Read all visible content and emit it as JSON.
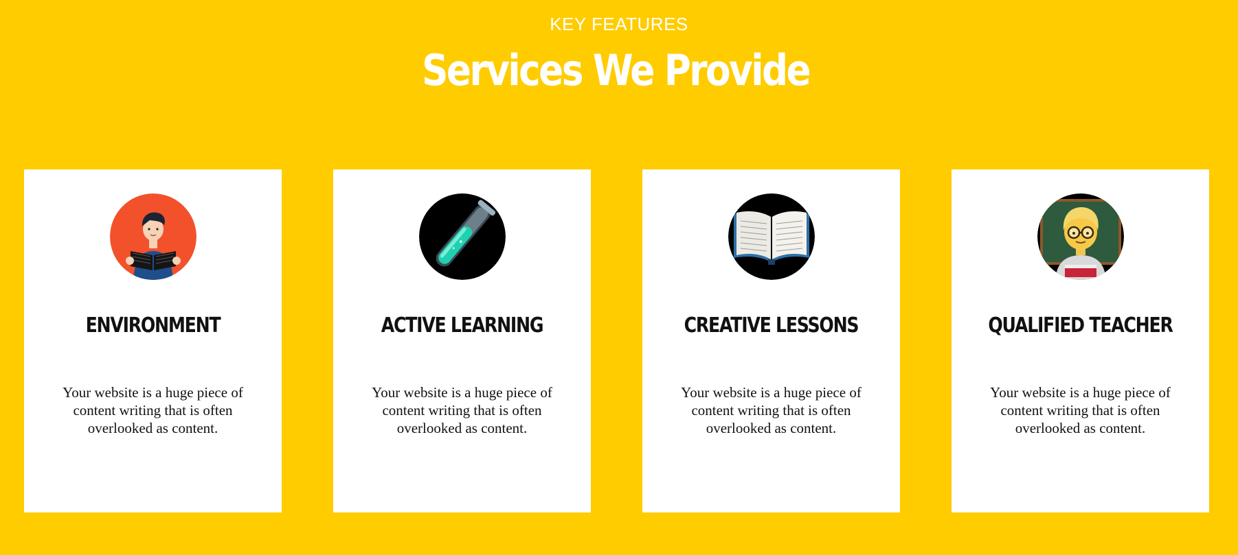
{
  "header": {
    "kicker": "KEY FEATURES",
    "title": "Services We Provide"
  },
  "colors": {
    "background": "#FFCC00",
    "card": "#FFFFFF",
    "heading": "#FFFFFF",
    "text": "#111111"
  },
  "cards": [
    {
      "icon": "reading-student-icon",
      "title": "ENVIRONMENT",
      "text": "Your website is a huge piece of content writing that is often overlooked as content."
    },
    {
      "icon": "test-tube-icon",
      "title": "ACTIVE LEARNING",
      "text": "Your website is a huge piece of content writing that is often overlooked as content."
    },
    {
      "icon": "open-book-icon",
      "title": "CREATIVE LESSONS",
      "text": "Your website is a huge piece of content writing that is often overlooked as content."
    },
    {
      "icon": "teacher-icon",
      "title": "QUALIFIED TEACHER",
      "text": "Your website is a huge piece of content writing that is often overlooked as content."
    }
  ]
}
